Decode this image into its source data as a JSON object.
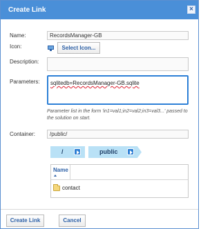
{
  "dialog": {
    "title": "Create Link",
    "close_label": "×"
  },
  "form": {
    "name_label": "Name:",
    "name_value": "RecordsManager-GB",
    "icon_label": "Icon:",
    "select_icon_label": "Select Icon...",
    "description_label": "Description:",
    "description_value": "",
    "parameters_label": "Parameters:",
    "parameters_value": "sqlitedb=RecordsManager-GB.sqlite",
    "parameters_hint": "Parameter list in the form 'in1=val1;in2=val2;in3=val3...' passed to the solution on start.",
    "container_label": "Container:",
    "container_value": "/public/"
  },
  "breadcrumb": {
    "items": [
      "/",
      "public"
    ]
  },
  "file_list": {
    "column_name": "Name",
    "rows": [
      "contact"
    ]
  },
  "footer": {
    "create_label": "Create Link",
    "cancel_label": "Cancel"
  },
  "colors": {
    "titlebar": "#4a8fd8",
    "focus_border": "#2c7fd6",
    "breadcrumb": "#b9e1f6"
  }
}
